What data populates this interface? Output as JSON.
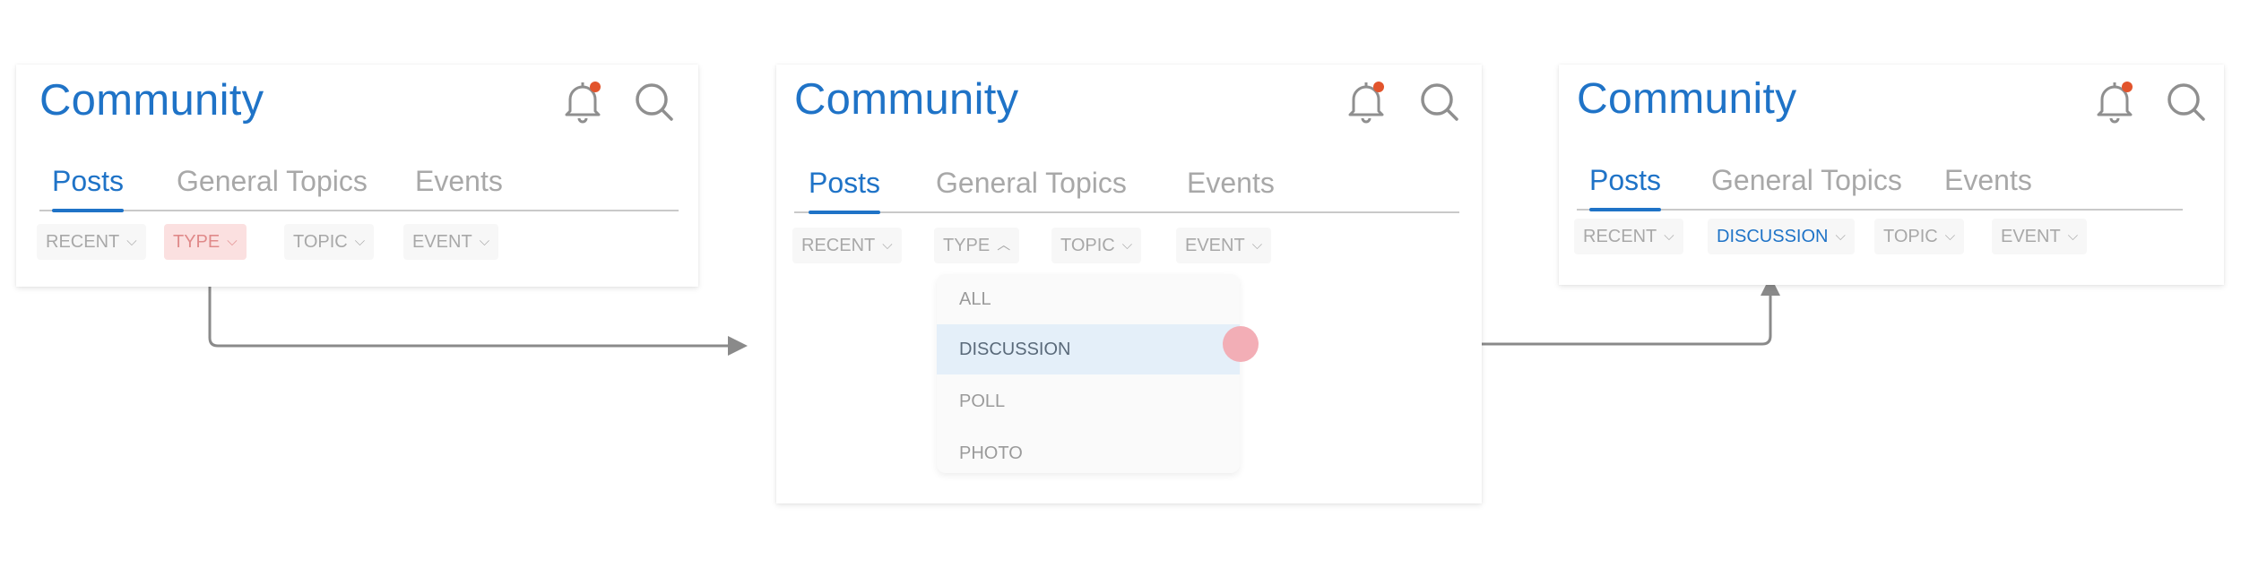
{
  "colors": {
    "brand_blue": "#1f73c7",
    "muted_text": "#a8a8a8",
    "notification_dot": "#e2542c",
    "chip_highlight_bg": "#fbe0e0",
    "chip_highlight_text": "#e08a8a",
    "option_active_bg": "#e4eff9",
    "touch_indicator": "#f2aab2",
    "arrow": "#8a8a8a"
  },
  "icons": {
    "notification": "bell-icon",
    "notification_badge": "notification-badge",
    "search": "search-icon",
    "chevron_down": "chevron-down-icon",
    "chevron_up": "chevron-up-icon",
    "caret_down_glyph": "⌵",
    "caret_up_glyph": "︿"
  },
  "panel1": {
    "title": "Community",
    "tabs": [
      "Posts",
      "General Topics",
      "Events"
    ],
    "active_tab": "Posts",
    "filters": [
      "RECENT",
      "TYPE",
      "TOPIC",
      "EVENT"
    ],
    "highlighted_filter": "TYPE"
  },
  "panel2": {
    "title": "Community",
    "tabs": [
      "Posts",
      "General Topics",
      "Events"
    ],
    "active_tab": "Posts",
    "filters": [
      "RECENT",
      "TYPE",
      "TOPIC",
      "EVENT"
    ],
    "open_filter": "TYPE",
    "dropdown": {
      "options": [
        "ALL",
        "DISCUSSION",
        "POLL",
        "PHOTO"
      ],
      "active_option": "DISCUSSION"
    }
  },
  "panel3": {
    "title": "Community",
    "tabs": [
      "Posts",
      "General Topics",
      "Events"
    ],
    "active_tab": "Posts",
    "filters": [
      "RECENT",
      "DISCUSSION",
      "TOPIC",
      "EVENT"
    ],
    "selected_filter": "DISCUSSION"
  }
}
